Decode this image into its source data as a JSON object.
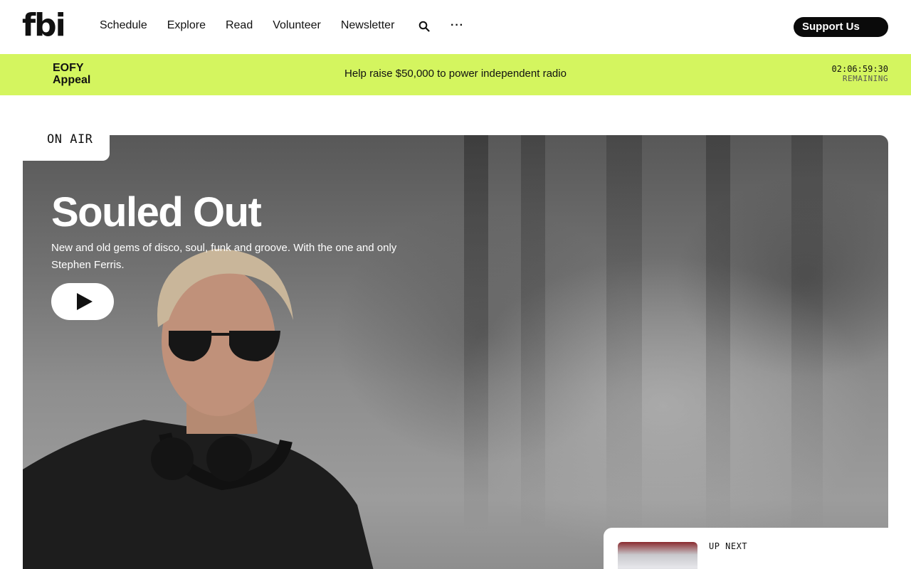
{
  "header": {
    "logo": "fbi",
    "nav": [
      "Schedule",
      "Explore",
      "Read",
      "Volunteer",
      "Newsletter"
    ],
    "more": "···",
    "support_label": "Support Us"
  },
  "banner": {
    "title": "EOFY Appeal",
    "message": "Help raise $50,000 to power independent radio",
    "countdown": "02:06:59:30",
    "countdown_label": "REMAINING",
    "color": "#d4f55f"
  },
  "hero": {
    "badge": "ON AIR",
    "title": "Souled Out",
    "description": "New and old gems of disco, soul, funk and groove. With the one and only Stephen Ferris."
  },
  "up_next": {
    "label": "UP NEXT"
  },
  "icons": {
    "search": "search-icon",
    "play": "play-icon"
  }
}
